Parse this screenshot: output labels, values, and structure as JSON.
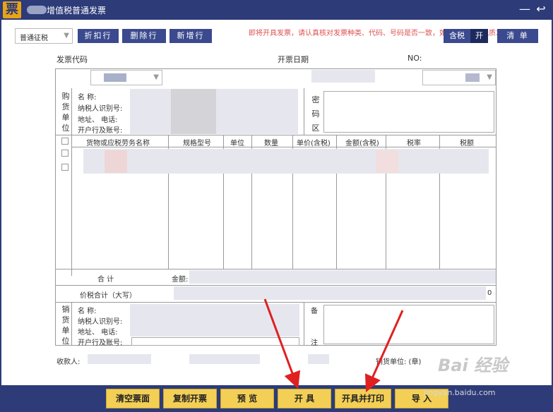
{
  "window": {
    "title": "增值税普通发票",
    "logo_char": "票",
    "minimize": "—",
    "back": "↩"
  },
  "notice": "即将开具发票，请认真核对发票种类、代码、号码是否一致，如不同请更换纸质发票",
  "toolbar": {
    "invoice_type": "普通征税",
    "discount_label": "折扣行",
    "delete_label": "删除行",
    "add_label": "新增行",
    "tax_incl_label": "含税",
    "tax_incl_state": "开",
    "list_label": "清 单"
  },
  "header": {
    "code_label": "发票代码",
    "date_label": "开票日期",
    "no_label": "NO:"
  },
  "buyer": {
    "side": [
      "购",
      "货",
      "单",
      "位"
    ],
    "name_label": "名        称:",
    "tax_id_label": "纳税人识别号:",
    "address_label": "地址、  电话:",
    "bank_label": "开户行及账号:",
    "secret_side": [
      "密",
      "码",
      "区"
    ]
  },
  "items": {
    "columns": [
      "货物或应税劳务名称",
      "规格型号",
      "单位",
      "数量",
      "单价(含税)",
      "金额(含税)",
      "税率",
      "税额"
    ]
  },
  "totals": {
    "sum_label": "合    计",
    "amount_label": "金额:",
    "total_label": "价税合计（大写）",
    "total_tail": "0"
  },
  "seller": {
    "side": [
      "销",
      "货",
      "单",
      "位"
    ],
    "name_label": "名        称:",
    "tax_id_label": "纳税人识别号:",
    "address_label": "地址、  电话:",
    "bank_label": "开户行及账号:",
    "remark_side": [
      "备",
      "注"
    ]
  },
  "footer": {
    "payee_label": "收款人:",
    "seller_unit_label": "销货单位:  (章)"
  },
  "actions": {
    "clear": "清空票面",
    "copy": "复制开票",
    "preview": "预 览",
    "issue": "开 具",
    "issue_print": "开具并打印",
    "import": "导 入"
  },
  "watermark": {
    "brand": "Bai 经验",
    "url": "jingyan.baidu.com"
  }
}
